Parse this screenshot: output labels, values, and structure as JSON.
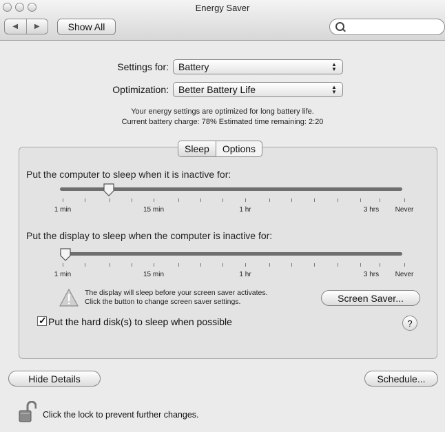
{
  "window": {
    "title": "Energy Saver"
  },
  "toolbar": {
    "back": "◀",
    "forward": "▶",
    "show_all": "Show All",
    "search_placeholder": ""
  },
  "settings": {
    "settings_for_label": "Settings for:",
    "settings_for_value": "Battery",
    "optimization_label": "Optimization:",
    "optimization_value": "Better Battery Life",
    "info_line1": "Your energy settings are optimized for long battery life.",
    "info_line2": "Current battery charge: 78%  Estimated time remaining: 2:20"
  },
  "tabs": [
    {
      "label": "Sleep",
      "selected": true
    },
    {
      "label": "Options",
      "selected": false
    }
  ],
  "computer_sleep": {
    "heading": "Put the computer to sleep when it is inactive for:",
    "value_label": "about 10 min",
    "tick_labels": [
      "1 min",
      "15 min",
      "1 hr",
      "3 hrs",
      "Never"
    ]
  },
  "display_sleep": {
    "heading": "Put the display to sleep when the computer is inactive for:",
    "value_label": "1 min",
    "tick_labels": [
      "1 min",
      "15 min",
      "1 hr",
      "3 hrs",
      "Never"
    ]
  },
  "warning": {
    "line1": "The display will sleep before your screen saver activates.",
    "line2": "Click the button to change screen saver settings.",
    "button": "Screen Saver..."
  },
  "hard_disk": {
    "label": "Put the hard disk(s) to sleep when possible",
    "checked": true
  },
  "help": "?",
  "footer": {
    "hide_details": "Hide Details",
    "schedule": "Schedule...",
    "lock_text": "Click the lock to prevent further changes."
  },
  "colors": {
    "window_bg": "#ebebeb",
    "group_bg": "#e3e3e3",
    "warning": "#c9c9c9"
  }
}
